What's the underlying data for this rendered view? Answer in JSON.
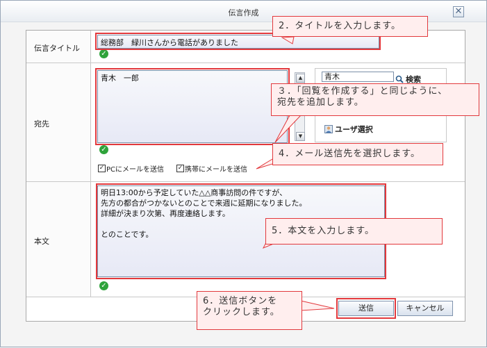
{
  "dialog": {
    "title": "伝言作成",
    "close_label": "✕"
  },
  "labels": {
    "title": "伝言タイトル",
    "recipient": "宛先",
    "body": "本文"
  },
  "title_value": "総務部　緑川さんから電話がありました",
  "recipient_list": "青木　一郎",
  "search": {
    "value": "青木",
    "button": "検索"
  },
  "user_select": "ユーザ選択",
  "checkboxes": {
    "pc": "PCにメールを送信",
    "mobile": "携帯にメールを送信"
  },
  "body_lines": [
    "明日13:00から予定していた△△商事訪問の件ですが、",
    "先方の都合がつかないとのことで来週に延期になりました。",
    "詳細が決まり次第、再度連絡します。",
    "",
    "とのことです。"
  ],
  "buttons": {
    "send": "送信",
    "cancel": "キャンセル"
  },
  "callouts": {
    "c2": "2．タイトルを入力します。",
    "c3_line1": "３．「回覧を作成する」と同じように、",
    "c3_line2": "宛先を追加します。",
    "c4": "4．メール送信先を選択します。",
    "c5": "5．本文を入力します。",
    "c6_line1": "6．送信ボタンを",
    "c6_line2": "クリックします。"
  },
  "colors": {
    "callout_border": "#e2383c",
    "callout_bg": "#ffeeee",
    "check": "#2fa33b"
  }
}
